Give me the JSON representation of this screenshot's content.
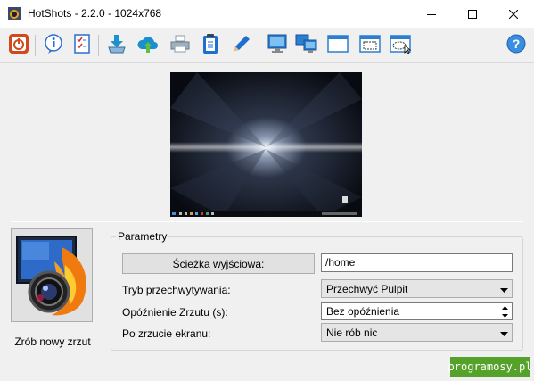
{
  "window": {
    "title": "HotShots - 2.2.0 - 1024x768",
    "controls": [
      "minimize",
      "maximize",
      "close"
    ]
  },
  "toolbar": {
    "buttons": [
      {
        "name": "power-icon",
        "color": "#d04a1e"
      },
      {
        "name": "info-icon",
        "color": "#2a6fd0"
      },
      {
        "name": "checklist-icon",
        "color": "#2a6fd0"
      },
      {
        "name": "save-download-icon",
        "color": "#1e90d0"
      },
      {
        "name": "cloud-upload-icon",
        "color": "#1a8fd0"
      },
      {
        "name": "printer-icon",
        "color": "#8a9aa8"
      },
      {
        "name": "clipboard-icon",
        "color": "#1e6fd0"
      },
      {
        "name": "pencil-edit-icon",
        "color": "#1e6fd0"
      },
      {
        "name": "monitor-icon",
        "color": "#2a7fd0"
      },
      {
        "name": "multi-monitor-icon",
        "color": "#2a7fd0"
      },
      {
        "name": "window-icon",
        "color": "#2a7fd0"
      },
      {
        "name": "region-select-icon",
        "color": "#2a7fd0"
      },
      {
        "name": "freehand-region-icon",
        "color": "#2a7fd0"
      },
      {
        "name": "help-icon",
        "color": "#3a8ee0"
      }
    ]
  },
  "capture": {
    "button_label": "Zrób nowy zrzut"
  },
  "params": {
    "group_title": "Parametry",
    "output_path_button": "Ścieżka wyjściowa:",
    "output_path_value": "/home",
    "capture_mode_label": "Tryb przechwytywania:",
    "capture_mode_value": "Przechwyć Pulpit",
    "delay_label": "Opóźnienie Zrzutu (s):",
    "delay_value": "Bez opóźnienia",
    "after_capture_label": "Po zrzucie ekranu:",
    "after_capture_value": "Nie rób nic"
  },
  "watermark": "programosy.pl"
}
